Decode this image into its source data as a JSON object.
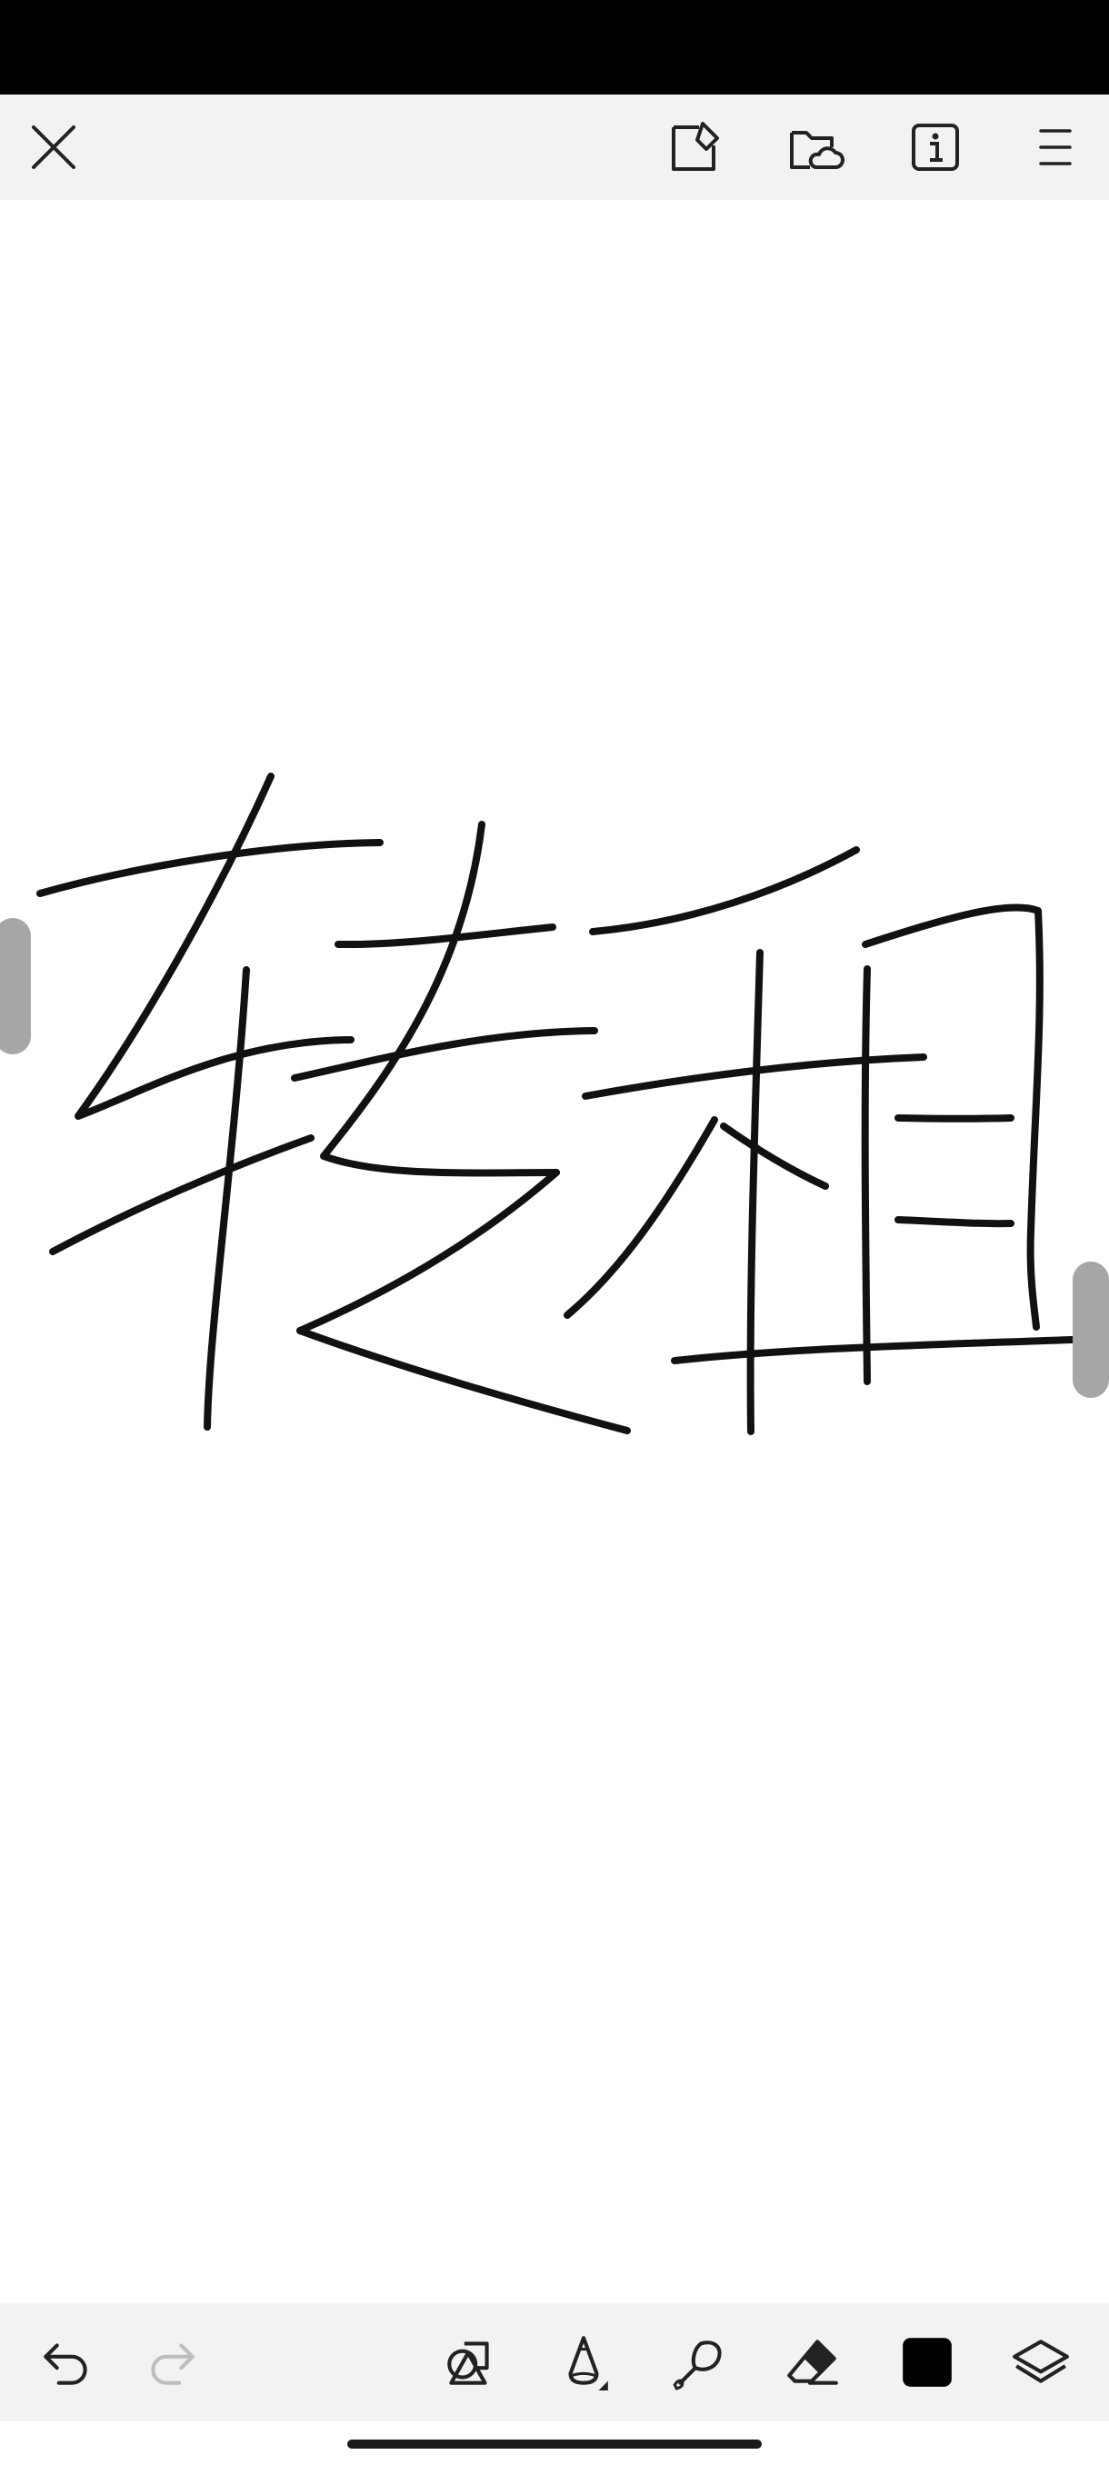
{
  "app": {
    "mode": "sketch-canvas"
  },
  "top_toolbar": {
    "icons": [
      "close-icon",
      "export-icon",
      "save-to-cloud-icon",
      "info-icon",
      "menu-icon"
    ]
  },
  "canvas": {
    "content": "handwritten-strokes",
    "stroke_color": "#111111"
  },
  "bottom_toolbar": {
    "icons": [
      "undo-icon",
      "redo-icon",
      "shapes-icon",
      "pencil-icon",
      "brush-icon",
      "eraser-icon",
      "color-swatch",
      "layers-icon"
    ],
    "redo_enabled": false,
    "current_color": "#000000"
  },
  "colors": {
    "toolbar_bg": "#f2f2f2",
    "status_bar": "#000000",
    "handle": "#a6a6a6",
    "disabled_icon": "#bdbdbd"
  }
}
